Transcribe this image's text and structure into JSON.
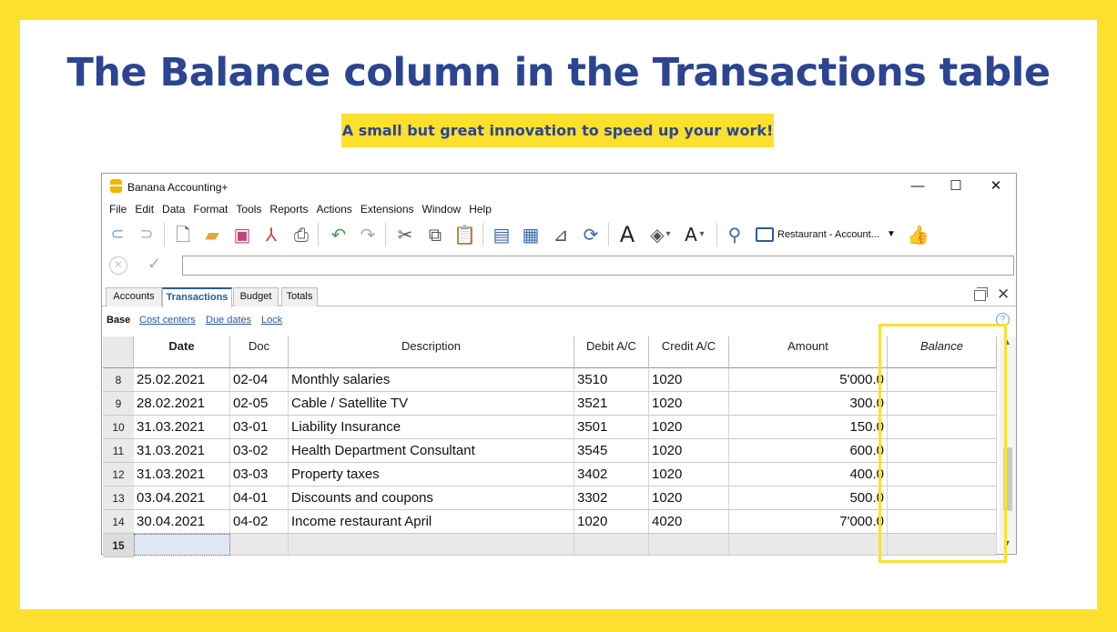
{
  "headline": "The Balance column in the Transactions table",
  "subline": "A small but great innovation to speed up your work!",
  "window": {
    "title": "Banana Accounting+",
    "controls": {
      "minimize": "—",
      "maximize": "☐",
      "close": "✕"
    }
  },
  "menu": [
    "File",
    "Edit",
    "Data",
    "Format",
    "Tools",
    "Reports",
    "Actions",
    "Extensions",
    "Window",
    "Help"
  ],
  "toolbar": {
    "file_selector": "Restaurant - Account...",
    "icons": [
      "back-icon",
      "forward-icon",
      "new-file-icon",
      "open-folder-icon",
      "save-icon",
      "pdf-icon",
      "print-preview-icon",
      "undo-icon",
      "redo-icon",
      "cut-icon",
      "copy-icon",
      "paste-icon",
      "insert-rows-icon",
      "add-rows-icon",
      "edit-row-icon",
      "recheck-icon",
      "font-icon",
      "fill-color-icon",
      "text-color-icon",
      "find-icon",
      "thumbs-up-icon"
    ]
  },
  "tabs": [
    "Accounts",
    "Transactions",
    "Budget",
    "Totals"
  ],
  "active_tab": "Transactions",
  "views": [
    "Base",
    "Cost centers",
    "Due dates",
    "Lock"
  ],
  "grid": {
    "headers": [
      "Date",
      "Doc",
      "Description",
      "Debit A/C",
      "Credit A/C",
      "Amount",
      "Balance"
    ],
    "rows": [
      {
        "n": "8",
        "date": "25.02.2021",
        "doc": "02-04",
        "desc": "Monthly salaries",
        "debit": "3510",
        "credit": "1020",
        "amount": "5'000.0",
        "balance": ""
      },
      {
        "n": "9",
        "date": "28.02.2021",
        "doc": "02-05",
        "desc": "Cable / Satellite TV",
        "debit": "3521",
        "credit": "1020",
        "amount": "300.0",
        "balance": ""
      },
      {
        "n": "10",
        "date": "31.03.2021",
        "doc": "03-01",
        "desc": "Liability Insurance",
        "debit": "3501",
        "credit": "1020",
        "amount": "150.0",
        "balance": ""
      },
      {
        "n": "11",
        "date": "31.03.2021",
        "doc": "03-02",
        "desc": "Health Department Consultant",
        "debit": "3545",
        "credit": "1020",
        "amount": "600.0",
        "balance": ""
      },
      {
        "n": "12",
        "date": "31.03.2021",
        "doc": "03-03",
        "desc": "Property taxes",
        "debit": "3402",
        "credit": "1020",
        "amount": "400.0",
        "balance": ""
      },
      {
        "n": "13",
        "date": "03.04.2021",
        "doc": "04-01",
        "desc": "Discounts and coupons",
        "debit": "3302",
        "credit": "1020",
        "amount": "500.0",
        "balance": ""
      },
      {
        "n": "14",
        "date": "30.04.2021",
        "doc": "04-02",
        "desc": "Income restaurant April",
        "debit": "1020",
        "credit": "4020",
        "amount": "7'000.0",
        "balance": ""
      }
    ],
    "new_row": "15"
  },
  "colors": {
    "brand_yellow": "#fce02e",
    "headline_blue": "#2b4592",
    "link_blue": "#2a5aa0"
  }
}
